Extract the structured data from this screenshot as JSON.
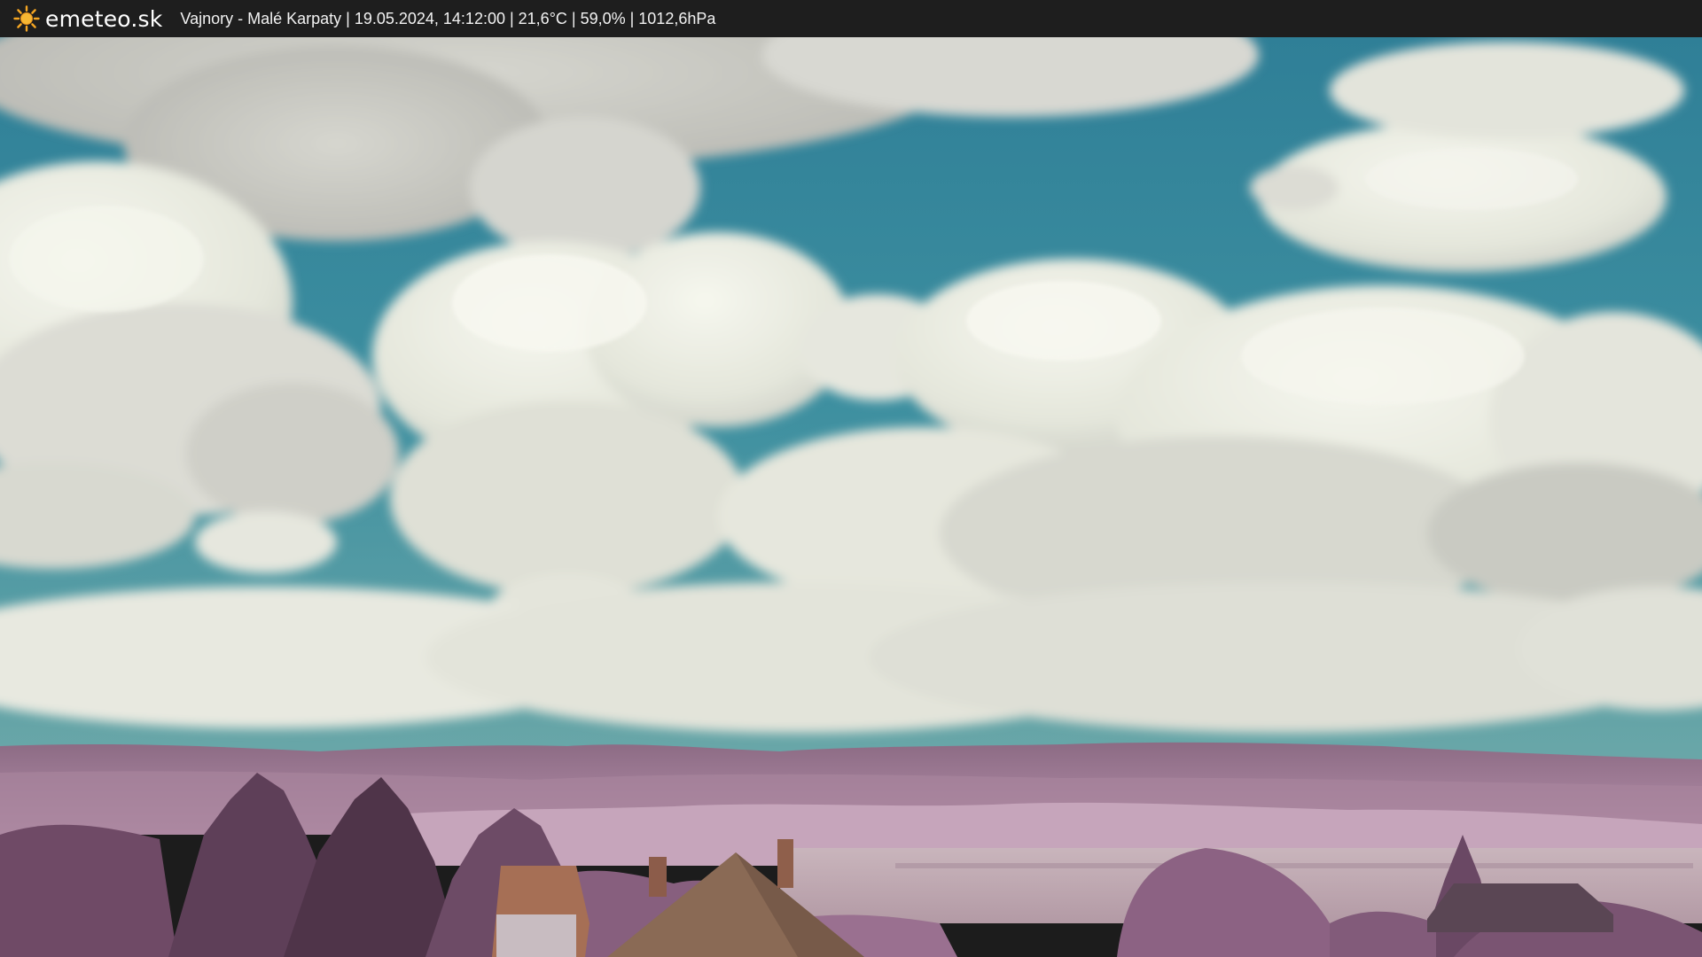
{
  "header": {
    "logo_icon": "sun-icon",
    "brand": "emeteo.sk",
    "caption": "Vajnory - Malé Karpaty | 19.05.2024, 14:12:00 | 21,6°C | 59,0% | 1012,6hPa"
  },
  "colors": {
    "bar_background": "#1e1e1e",
    "sun": "#f5a623",
    "sky": "#3f8fa2",
    "cloud": "#eceee3",
    "hills": "#9c7a92",
    "foliage": "#8a5f7c",
    "roof": "#9c6a52"
  }
}
